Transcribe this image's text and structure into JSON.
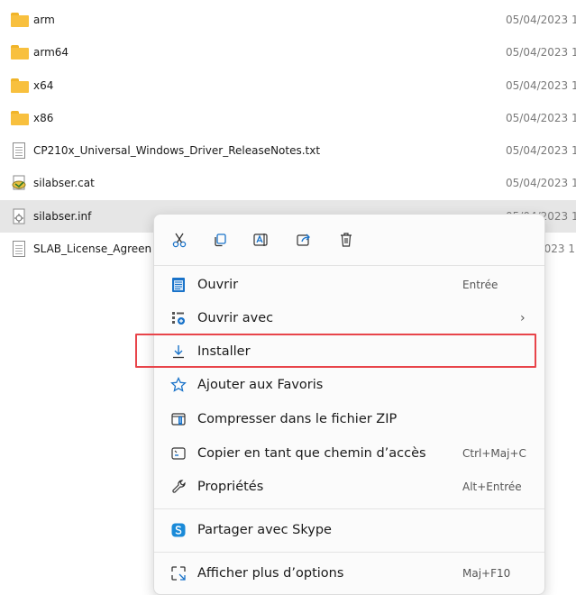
{
  "files": [
    {
      "name": "arm",
      "date": "05/04/2023 1",
      "type": "folder"
    },
    {
      "name": "arm64",
      "date": "05/04/2023 1",
      "type": "folder"
    },
    {
      "name": "x64",
      "date": "05/04/2023 1",
      "type": "folder"
    },
    {
      "name": "x86",
      "date": "05/04/2023 1",
      "type": "folder"
    },
    {
      "name": "CP210x_Universal_Windows_Driver_ReleaseNotes.txt",
      "date": "05/04/2023 1",
      "type": "text-file"
    },
    {
      "name": "silabser.cat",
      "date": "05/04/2023 1",
      "type": "catalog-file"
    },
    {
      "name": "silabser.inf",
      "date": "05/04/2023 1",
      "type": "inf-file"
    },
    {
      "name": "SLAB_License_Agreen",
      "date": "2023 1",
      "type": "text-file"
    }
  ],
  "context_menu": {
    "quick_actions": [
      "cut-icon",
      "copy-icon",
      "rename-icon",
      "share-icon",
      "delete-icon"
    ],
    "items": [
      {
        "label": "Ouvrir",
        "shortcut": "Entrée",
        "icon": "notepad-icon"
      },
      {
        "label": "Ouvrir avec",
        "shortcut": "",
        "icon": "open-with-icon",
        "submenu": "›"
      },
      {
        "label": "Installer",
        "shortcut": "",
        "icon": "download-icon"
      },
      {
        "label": "Ajouter aux Favoris",
        "shortcut": "",
        "icon": "star-icon"
      },
      {
        "label": "Compresser dans le fichier ZIP",
        "shortcut": "",
        "icon": "zip-icon"
      },
      {
        "label": "Copier en tant que chemin d’accès",
        "shortcut": "Ctrl+Maj+C",
        "icon": "path-icon"
      },
      {
        "label": "Propriétés",
        "shortcut": "Alt+Entrée",
        "icon": "wrench-icon"
      },
      {
        "label": "Partager avec Skype",
        "shortcut": "",
        "icon": "skype-icon"
      },
      {
        "label": "Afficher plus d’options",
        "shortcut": "Maj+F10",
        "icon": "more-options-icon"
      }
    ]
  },
  "colors": {
    "highlight_box": "#e8444a",
    "selected_row": "#e6e6e6",
    "folder": "#f8c03e",
    "accent_blue": "#1a73c9"
  }
}
